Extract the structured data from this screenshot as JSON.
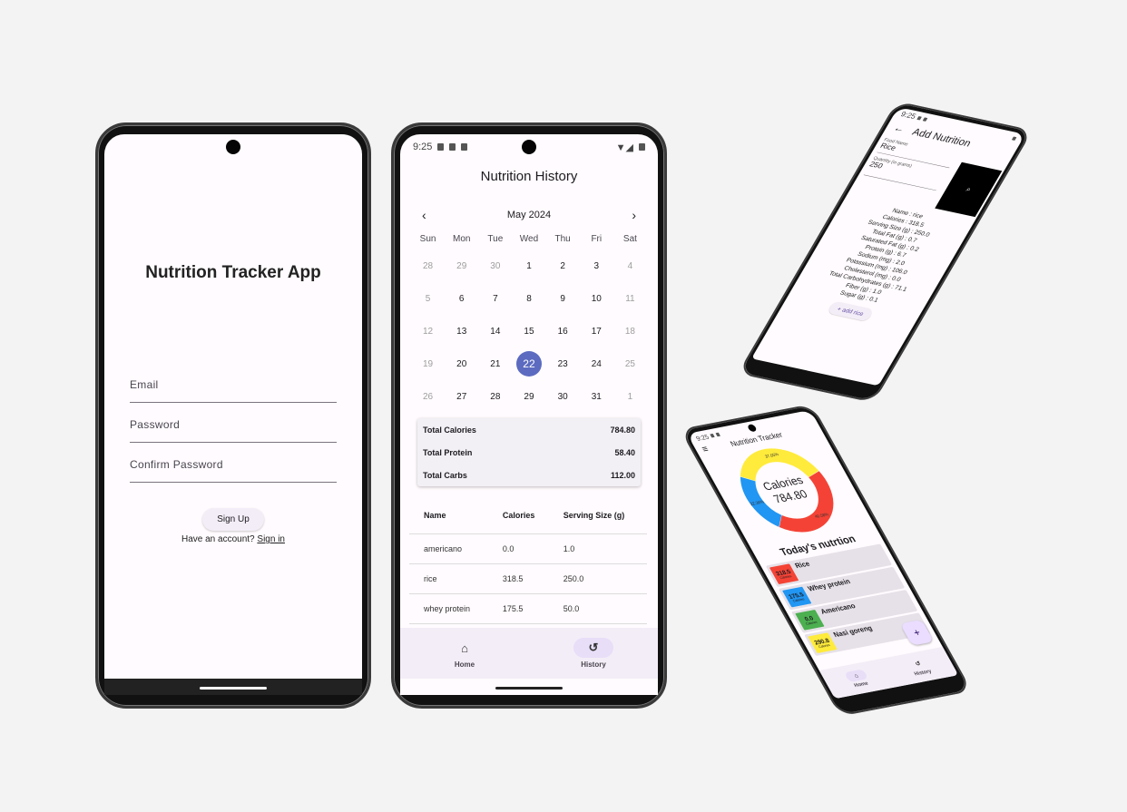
{
  "signup": {
    "title": "Nutrition Tracker App",
    "email_placeholder": "Email",
    "password_placeholder": "Password",
    "confirm_placeholder": "Confirm Password",
    "signup_button": "Sign Up",
    "have_account": "Have an account?",
    "signin_link": "Sign in"
  },
  "status": {
    "time": "9:25"
  },
  "history": {
    "title": "Nutrition History",
    "month": "May 2024",
    "weekdays": [
      "Sun",
      "Mon",
      "Tue",
      "Wed",
      "Thu",
      "Fri",
      "Sat"
    ],
    "weeks": [
      [
        "28",
        "29",
        "30",
        "1",
        "2",
        "3",
        "4"
      ],
      [
        "5",
        "6",
        "7",
        "8",
        "9",
        "10",
        "11"
      ],
      [
        "12",
        "13",
        "14",
        "15",
        "16",
        "17",
        "18"
      ],
      [
        "19",
        "20",
        "21",
        "22",
        "23",
        "24",
        "25"
      ],
      [
        "26",
        "27",
        "28",
        "29",
        "30",
        "31",
        "1"
      ]
    ],
    "selected_day": "22",
    "totals": [
      {
        "label": "Total Calories",
        "value": "784.80"
      },
      {
        "label": "Total Protein",
        "value": "58.40"
      },
      {
        "label": "Total Carbs",
        "value": "112.00"
      }
    ],
    "columns": [
      "Name",
      "Calories",
      "Serving Size (g)"
    ],
    "rows": [
      [
        "americano",
        "0.0",
        "1.0"
      ],
      [
        "rice",
        "318.5",
        "250.0"
      ],
      [
        "whey protein",
        "175.5",
        "50.0"
      ]
    ]
  },
  "nav": {
    "home": "Home",
    "history": "History"
  },
  "add": {
    "title": "Add Nutrition",
    "food_label": "Food Name",
    "food_value": "Rice",
    "qty_label": "Quantity (in grams)",
    "qty_value": "250",
    "details": [
      "Name : rice",
      "Calories : 318.5",
      "Serving Size (g) : 250.0",
      "Total Fat (g) : 0.7",
      "Saturated Fat (g) : 0.2",
      "Protein (g) : 6.7",
      "Sodium (mg) : 2.0",
      "Potassium (mg) : 106.0",
      "Cholesterol (mg) : 0.0",
      "Total Carbohydrates (g) : 71.1",
      "Fiber (g) : 1.0",
      "Sugar (g) : 0.1"
    ],
    "add_button": "add rice"
  },
  "home": {
    "title": "Nutrition Tracker",
    "center_label": "Calories",
    "center_value": "784.80",
    "section": "Today's nutrtion",
    "slices": [
      {
        "label": "37.05%",
        "value": 37.05,
        "color": "#ffeb3b"
      },
      {
        "label": "40.58%",
        "value": 40.58,
        "color": "#f44336"
      },
      {
        "label": "22.36%",
        "value": 22.36,
        "color": "#2196f3"
      }
    ],
    "items": [
      {
        "value": "318.5",
        "unit": "Calories",
        "name": "Rice",
        "color": "#f44336"
      },
      {
        "value": "175.5",
        "unit": "Calories",
        "name": "Whey protein",
        "color": "#2196f3"
      },
      {
        "value": "0.0",
        "unit": "Calories",
        "name": "Americano",
        "color": "#4caf50"
      },
      {
        "value": "290.8",
        "unit": "Calories",
        "name": "Nasi goreng",
        "color": "#ffeb3b"
      }
    ]
  }
}
